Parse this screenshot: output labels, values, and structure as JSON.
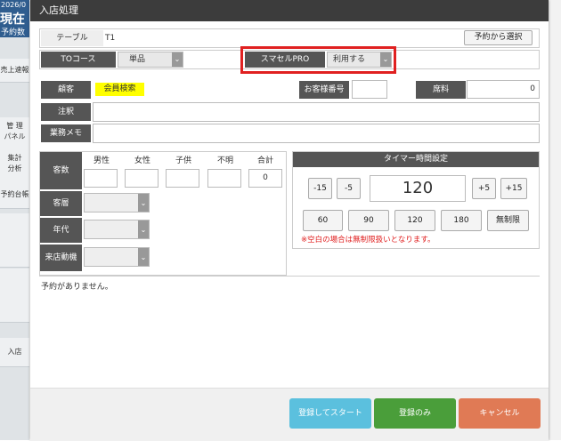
{
  "background": {
    "sidebar_top": [
      "2026/0",
      "現在",
      "予約数"
    ],
    "sidebar_items": [
      "売上速報",
      "管 理\nパネル",
      "集計\n分析",
      "予約台帳",
      "入店"
    ]
  },
  "modal": {
    "title": "入店処理",
    "table": {
      "label": "テーブル",
      "value": "T1",
      "reserve_button": "予約から選択"
    },
    "to_course": {
      "label": "TOコース",
      "value": "単品"
    },
    "smacell": {
      "label": "スマセルPRO",
      "value": "利用する"
    },
    "customer": {
      "label": "顧客",
      "search_button": "会員検索"
    },
    "customer_number": {
      "label": "お客様番号",
      "value": ""
    },
    "seat_fee": {
      "label": "席料",
      "value": "0"
    },
    "notes": {
      "label": "注釈",
      "value": ""
    },
    "business_memo": {
      "label": "業務メモ",
      "value": ""
    },
    "guests": {
      "label": "客数",
      "columns": [
        "男性",
        "女性",
        "子供",
        "不明",
        "合計"
      ],
      "values": [
        "",
        "",
        "",
        "",
        "0"
      ]
    },
    "customer_layer": {
      "label": "客層",
      "value": ""
    },
    "age_group": {
      "label": "年代",
      "value": ""
    },
    "visit_motive": {
      "label": "来店動機",
      "value": ""
    },
    "timer": {
      "title": "タイマー時間設定",
      "minus15": "-15",
      "minus5": "-5",
      "value": "120",
      "plus5": "+5",
      "plus15": "+15",
      "presets": [
        "60",
        "90",
        "120",
        "180",
        "無制限"
      ],
      "note": "※空白の場合は無制限扱いとなります。"
    },
    "no_reservation": "予約がありません。",
    "footer": {
      "start_button": "登録してスタート",
      "register_only": "登録のみ",
      "cancel": "キャンセル"
    }
  },
  "colors": {
    "header_bg": "#3c3c3c",
    "label_bg": "#555555",
    "highlight_border": "#e02020",
    "member_search_bg": "#ffff00",
    "start_button": "#5bc0de",
    "register_button": "#4a9e3a",
    "cancel_button": "#e07a55",
    "note_red": "#e02020"
  }
}
